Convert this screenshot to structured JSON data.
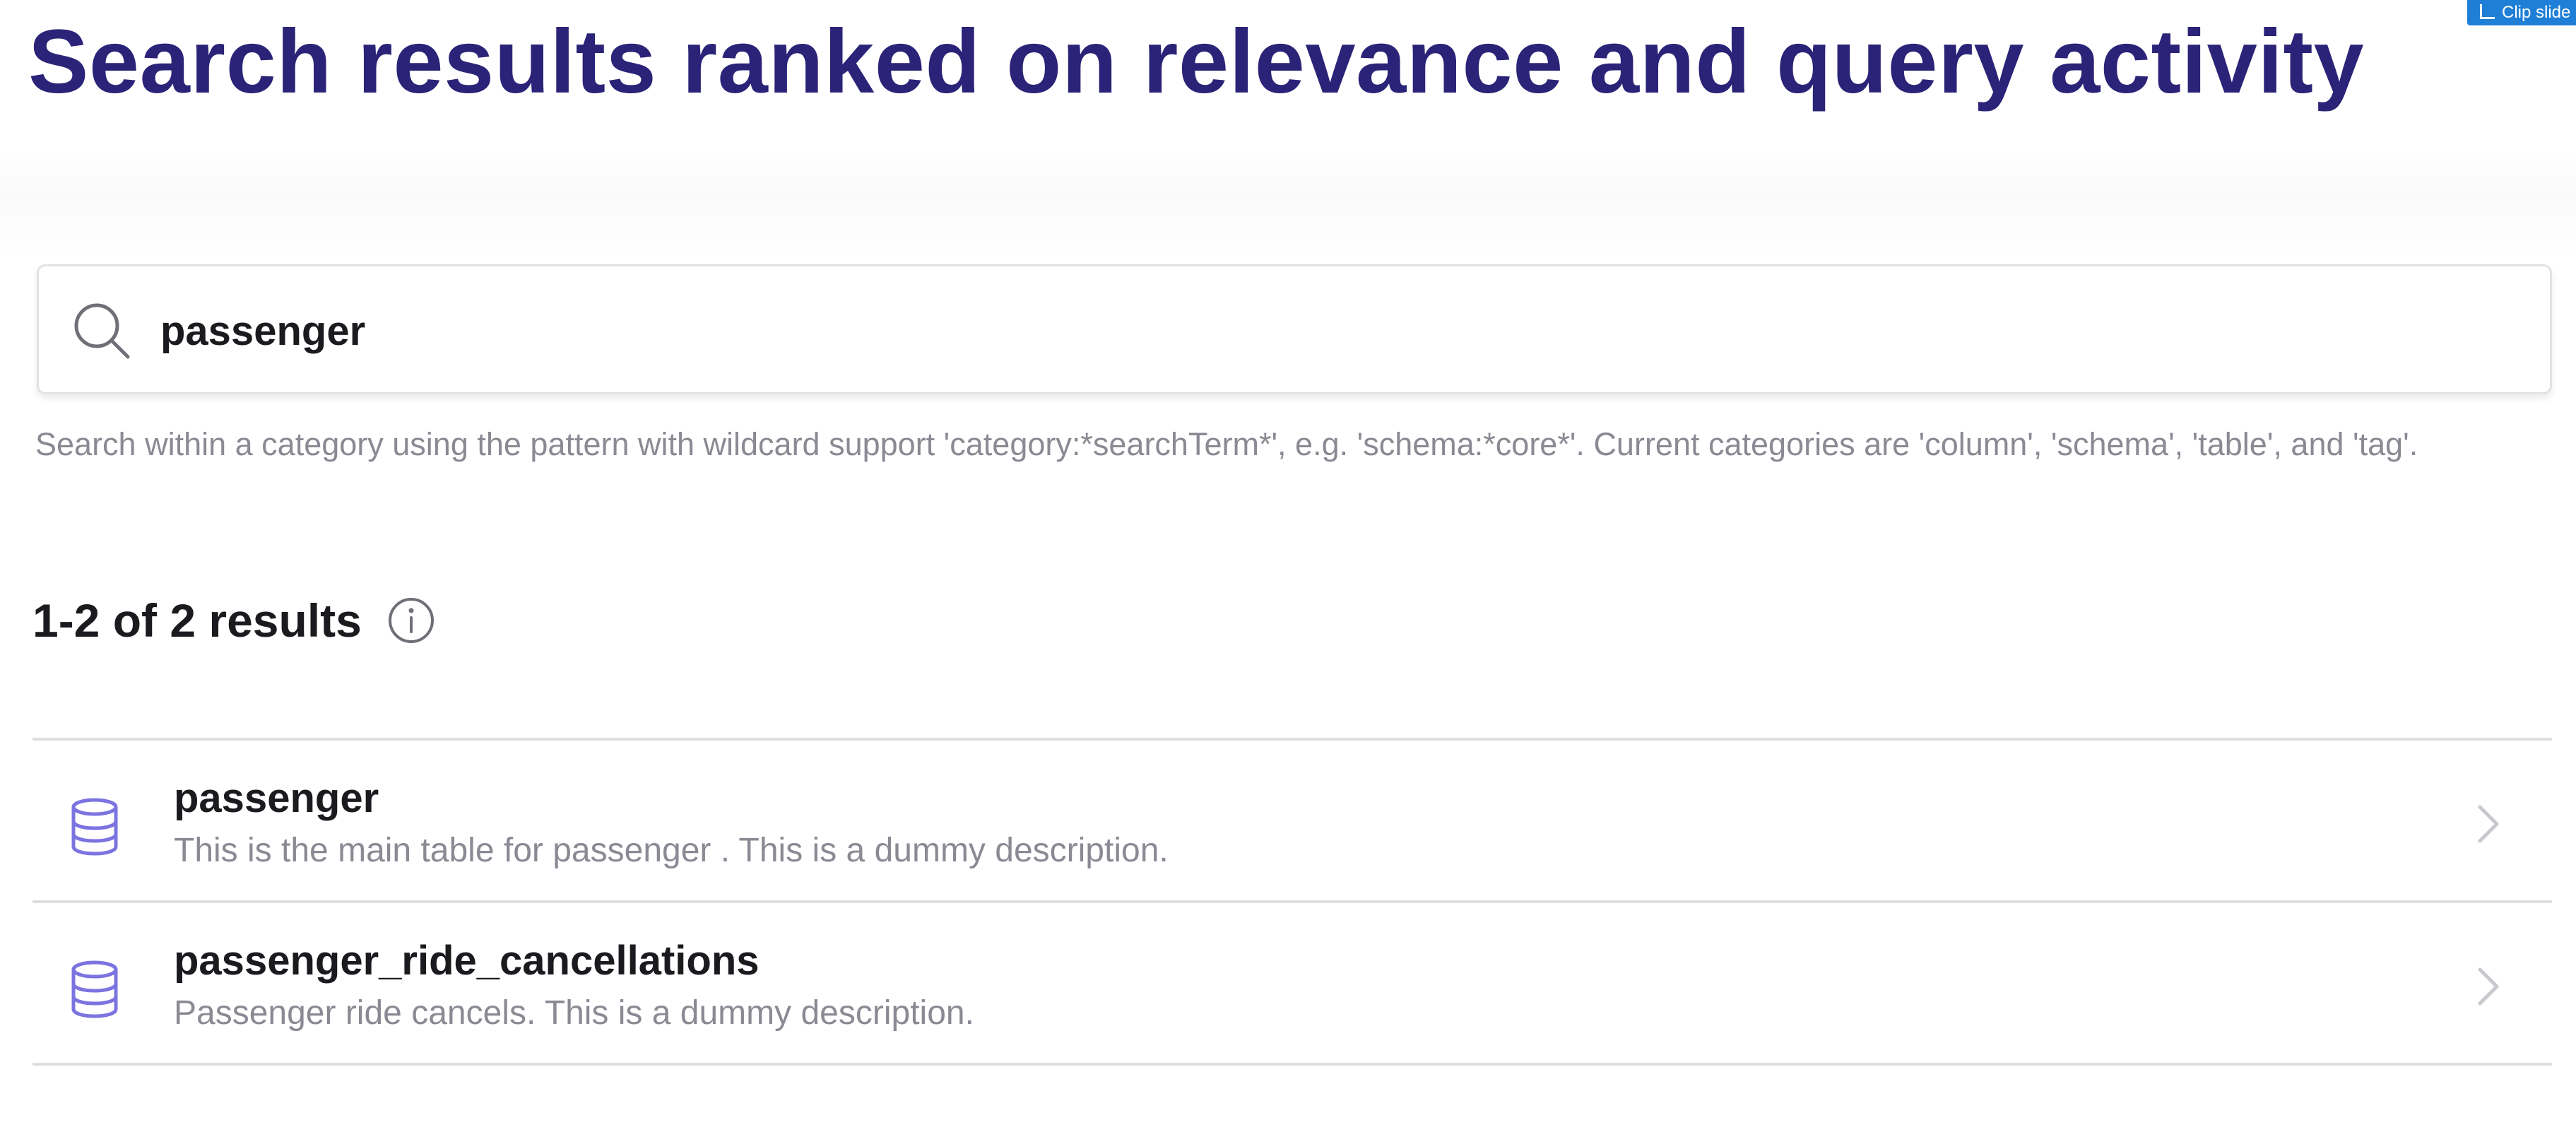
{
  "header": {
    "title": "Search results ranked on relevance and query activity",
    "clip_badge_label": "Clip slide"
  },
  "search": {
    "value": "passenger",
    "icon": "search-icon",
    "helper_text": "Search within a category using the pattern with wildcard support 'category:*searchTerm*', e.g. 'schema:*core*'. Current categories are 'column', 'schema', 'table', and 'tag'."
  },
  "results": {
    "count_label": "1-2 of 2 results",
    "info_icon": "info-icon",
    "items": [
      {
        "icon": "database-icon",
        "name": "passenger",
        "description": "This is the main table for passenger . This is a dummy description."
      },
      {
        "icon": "database-icon",
        "name": "passenger_ride_cancellations",
        "description": "Passenger ride cancels. This is a dummy description."
      }
    ]
  },
  "colors": {
    "title": "#2b2377",
    "icon_accent": "#7b74e0",
    "muted_text": "#8a8a94",
    "divider": "#dedee2",
    "badge": "#1f7fd6"
  }
}
